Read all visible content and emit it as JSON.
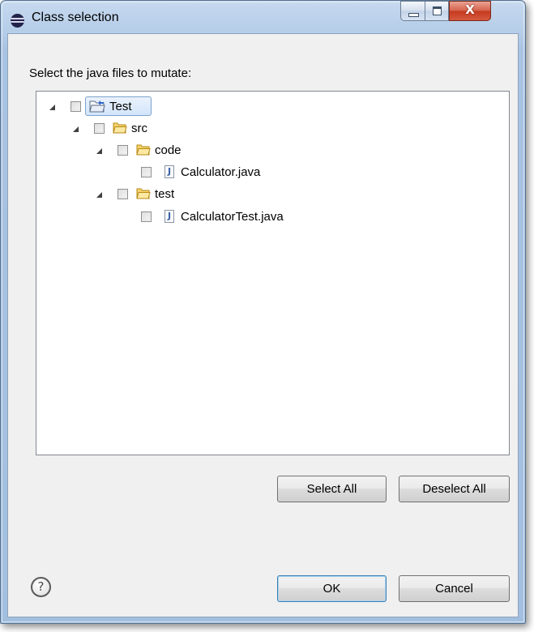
{
  "window": {
    "title": "Class selection",
    "close_glyph": "X"
  },
  "prompt": "Select the java files to mutate:",
  "tree": {
    "nodes": [
      {
        "label": "Test",
        "type": "project",
        "expanded": true,
        "checked": false,
        "selected": true
      },
      {
        "label": "src",
        "type": "folder",
        "expanded": true,
        "checked": false
      },
      {
        "label": "code",
        "type": "folder",
        "expanded": true,
        "checked": false
      },
      {
        "label": "Calculator.java",
        "type": "java-file",
        "checked": false
      },
      {
        "label": "test",
        "type": "folder",
        "expanded": true,
        "checked": false
      },
      {
        "label": "CalculatorTest.java",
        "type": "java-file",
        "checked": false
      }
    ]
  },
  "buttons": {
    "select_all": "Select All",
    "deselect_all": "Deselect All",
    "ok": "OK",
    "cancel": "Cancel"
  },
  "icons": {
    "help": "?",
    "java_glyph": "J"
  },
  "colors": {
    "frame": "#b5cde8",
    "close_button": "#c4391e",
    "folder": "#f0c23a",
    "selection": "#d3e5fb",
    "default_button_border": "#3c7fb1"
  }
}
